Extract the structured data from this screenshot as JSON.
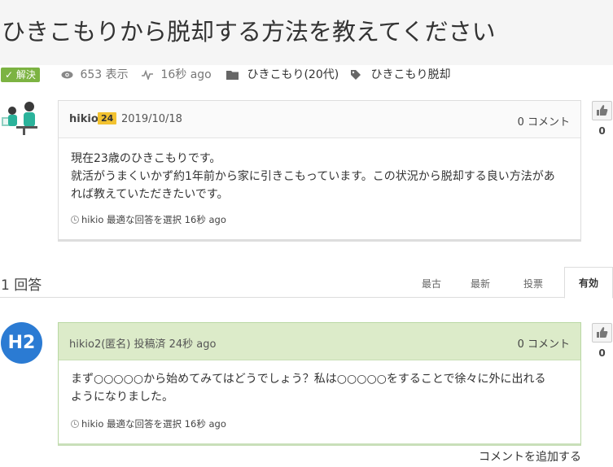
{
  "question": {
    "title": "ひきこもりから脱却する方法を教えてください",
    "status_badge": "✓ 解決",
    "views": "653 表示",
    "activity": "16秒 ago",
    "category": "ひきこもり(20代)",
    "tag": "ひきこもり脱却",
    "author": "hikio",
    "reputation": "24",
    "date": "2019/10/18",
    "comments": "0 コメント",
    "body_lines": [
      "現在23歳のひきこもりです。",
      "就活がうまくいかず約1年前から家に引きこもっています。この状況から脱却する良い方法があ",
      "れば教えていただきたいです。"
    ],
    "footer": "hikio 最適な回答を選択 16秒 ago",
    "votes": "0"
  },
  "answers_bar": {
    "count": "1 回答",
    "tabs": [
      "最古",
      "最新",
      "投票",
      "有効"
    ]
  },
  "answer": {
    "avatar_text": "H2",
    "header": "hikio2(匿名) 投稿済 24秒 ago",
    "comments": "0 コメント",
    "body_lines": [
      "まず○○○○○から始めてみてはどうでしょう？私は○○○○○をすることで徐々に外に出れる",
      "ようになりました。"
    ],
    "footer": "hikio 最適な回答を選択 16秒 ago",
    "votes": "0"
  },
  "add_comment": "コメントを追加する",
  "colors": {
    "solved_badge": "#7cb342",
    "answer_header": "#dcebc9",
    "avatar": "#2b7bd3",
    "reputation": "#f2c230"
  }
}
